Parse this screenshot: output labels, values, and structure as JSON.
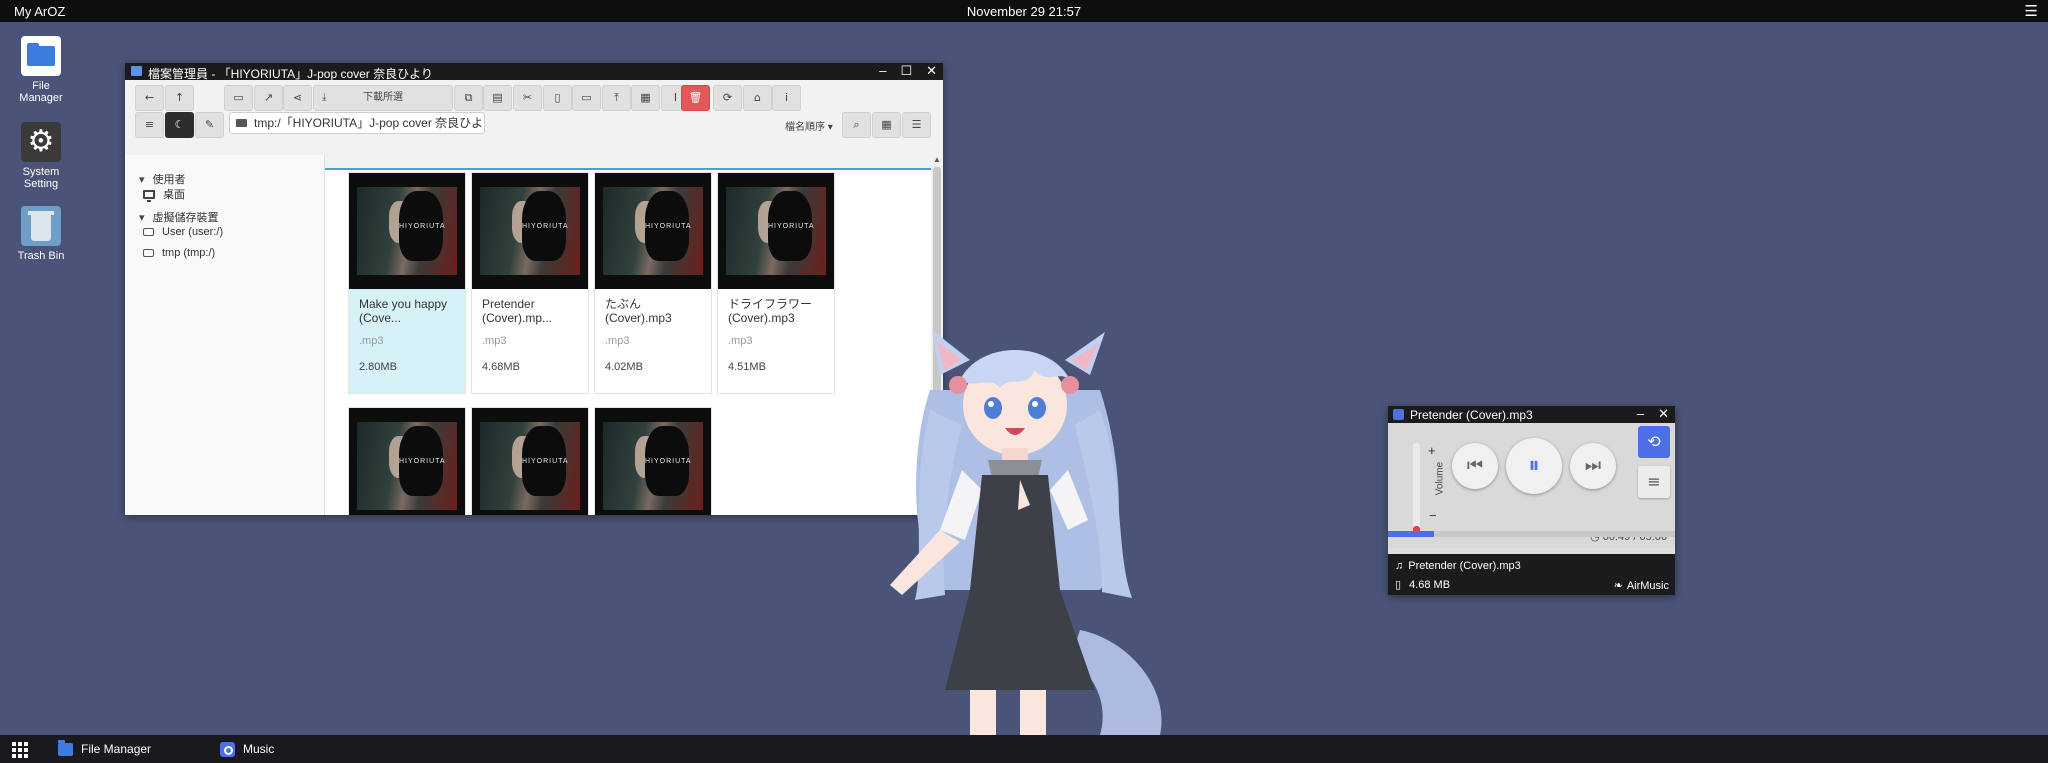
{
  "topbar": {
    "brand": "My ArOZ",
    "clock": "November 29 21:57",
    "menu_icon": "☰"
  },
  "desktop": {
    "icons": [
      {
        "label": "File Manager",
        "icon": "folder-icon"
      },
      {
        "label": "System Setting",
        "icon": "gear-icon"
      },
      {
        "label": "Trash Bin",
        "icon": "trash-icon"
      }
    ]
  },
  "file_manager": {
    "title": "檔案管理員 - 「HIYORIUTA」J-pop cover 奈良ひより",
    "window_buttons": [
      "–",
      "☐",
      "✕"
    ],
    "toolbar": {
      "download_label": "下載所選",
      "path": "tmp:/「HIYORIUTA」J-pop cover 奈良ひより",
      "sort_label": "檔名順序 ▾"
    },
    "sidebar": {
      "user_section": "使用者",
      "desktop_item": "桌面",
      "storage_section": "虛擬儲存裝置",
      "storage_items": [
        "User (user:/)",
        "tmp (tmp:/)"
      ]
    },
    "files": [
      {
        "name": "Make you happy (Cove...",
        "ext": ".mp3",
        "size": "2.80MB",
        "selected": true
      },
      {
        "name": "Pretender (Cover).mp...",
        "ext": ".mp3",
        "size": "4.68MB",
        "selected": false
      },
      {
        "name": "たぶん (Cover).mp3",
        "ext": ".mp3",
        "size": "4.02MB",
        "selected": false
      },
      {
        "name": "ドライフラワー (Cover).mp3",
        "ext": ".mp3",
        "size": "4.51MB",
        "selected": false
      },
      {
        "name": "",
        "ext": "",
        "size": "",
        "selected": false
      },
      {
        "name": "",
        "ext": "",
        "size": "",
        "selected": false
      },
      {
        "name": "",
        "ext": "",
        "size": "",
        "selected": false
      }
    ],
    "thumb_text": "HIYORIUTA"
  },
  "music_player": {
    "title": "Pretender (Cover).mp3",
    "volume_label": "Volume",
    "volume_level": 0.12,
    "time": "00:49 / 05:06",
    "progress": 0.16,
    "now_playing": "Pretender (Cover).mp3",
    "file_size": "4.68 MB",
    "brand": "AirMusic",
    "window_buttons": [
      "–",
      "✕"
    ]
  },
  "taskbar": {
    "items": [
      {
        "label": "File Manager",
        "icon": "folder-icon"
      },
      {
        "label": "Music",
        "icon": "music-icon"
      }
    ]
  },
  "colors": {
    "desktop_bg": "#4a5478",
    "accent_blue": "#4d6fe8",
    "delete_red": "#e25757",
    "selection": "#d6f1f7"
  }
}
